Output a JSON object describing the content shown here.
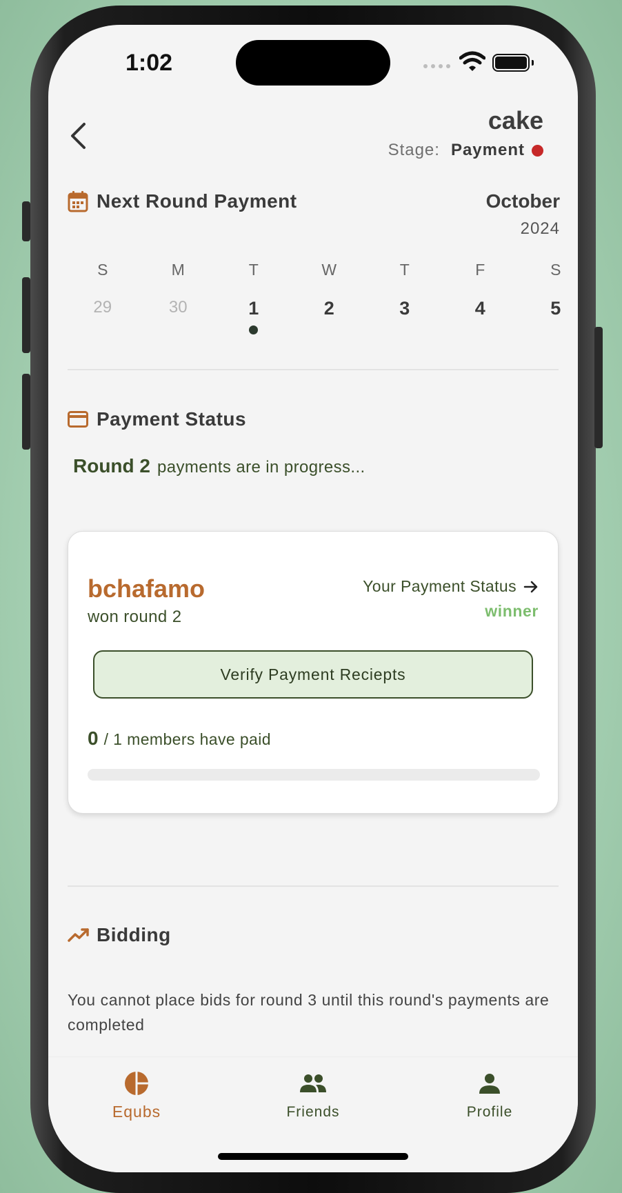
{
  "status_bar": {
    "time": "1:02"
  },
  "header": {
    "title": "cake",
    "stage_label": "Stage:",
    "stage_value": "Payment",
    "stage_dot_color": "#c62828"
  },
  "schedule": {
    "heading": "Next Round Payment",
    "month": "October",
    "year": "2024",
    "weekdays": [
      "S",
      "M",
      "T",
      "W",
      "T",
      "F",
      "S"
    ],
    "days": [
      "29",
      "30",
      "1",
      "2",
      "3",
      "4",
      "5"
    ],
    "muted_days": [
      "29",
      "30"
    ],
    "marked_day": "1"
  },
  "payment_status": {
    "heading": "Payment Status",
    "round_label": "Round 2",
    "progress_text": "payments are in progress...",
    "card": {
      "winner_name": "bchafamo",
      "won_text": "won round 2",
      "your_status_label": "Your Payment Status",
      "your_status_value": "winner",
      "verify_button_label": "Verify Payment Reciepts",
      "paid_count": "0",
      "paid_rest": "/ 1 members have paid",
      "paid_fraction": 0
    }
  },
  "bidding": {
    "heading": "Bidding",
    "message": "You cannot place bids for round 3 until this round's payments are completed"
  },
  "tabs": [
    {
      "label": "Equbs",
      "icon": "pie-chart-icon",
      "active": true
    },
    {
      "label": "Friends",
      "icon": "people-icon",
      "active": false
    },
    {
      "label": "Profile",
      "icon": "person-icon",
      "active": false
    }
  ],
  "colors": {
    "accent": "#b86a2e",
    "primary_green": "#3b4f2a",
    "winner_green": "#7dbd6e",
    "button_bg": "#e3efdd",
    "stage_red": "#c62828"
  }
}
